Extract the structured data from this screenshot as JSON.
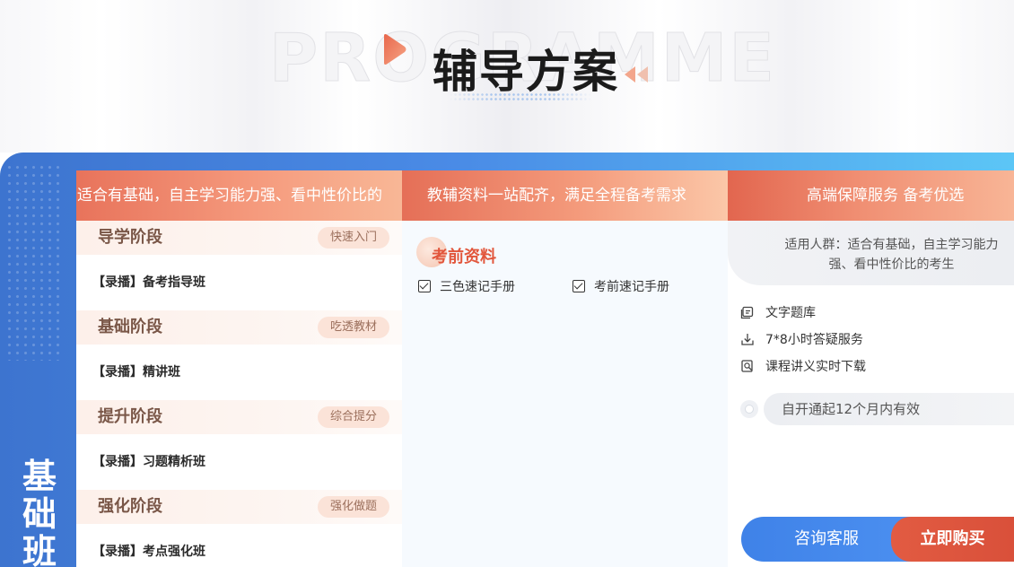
{
  "header": {
    "bg_word": "PROGRAMME",
    "title": "辅导方案"
  },
  "plan": {
    "class_name": "基础班"
  },
  "columns": {
    "col1_header": "适合有基础，自主学习能力强、看中性价比的",
    "col2_header": "教辅资料一站配齐，满足全程备考需求",
    "col3_header": "高端保障服务 备考优选"
  },
  "stages": [
    {
      "title": "导学阶段",
      "tag": "快速入门",
      "course": "【录播】备考指导班"
    },
    {
      "title": "基础阶段",
      "tag": "吃透教材",
      "course": "【录播】精讲班"
    },
    {
      "title": "提升阶段",
      "tag": "综合提分",
      "course": "【录播】习题精析班"
    },
    {
      "title": "强化阶段",
      "tag": "强化做题",
      "course": "【录播】考点强化班"
    }
  ],
  "materials": {
    "title": "考前资料",
    "items": [
      "三色速记手册",
      "考前速记手册"
    ]
  },
  "service": {
    "audience": "适用人群：适合有基础，自主学习能力强、看中性价比的考生",
    "items": [
      {
        "icon": "question-bank-icon",
        "label": "文字题库"
      },
      {
        "icon": "download-icon",
        "label": "7*8小时答疑服务"
      },
      {
        "icon": "document-search-icon",
        "label": "课程讲义实时下载"
      }
    ],
    "validity": "自开通起12个月内有效"
  },
  "actions": {
    "consult": "咨询客服",
    "buy": "立即购买"
  },
  "colors": {
    "primary_blue": "#3f82e8",
    "accent_red": "#e25b42",
    "stage_tag_bg": "#fbe3d8"
  }
}
